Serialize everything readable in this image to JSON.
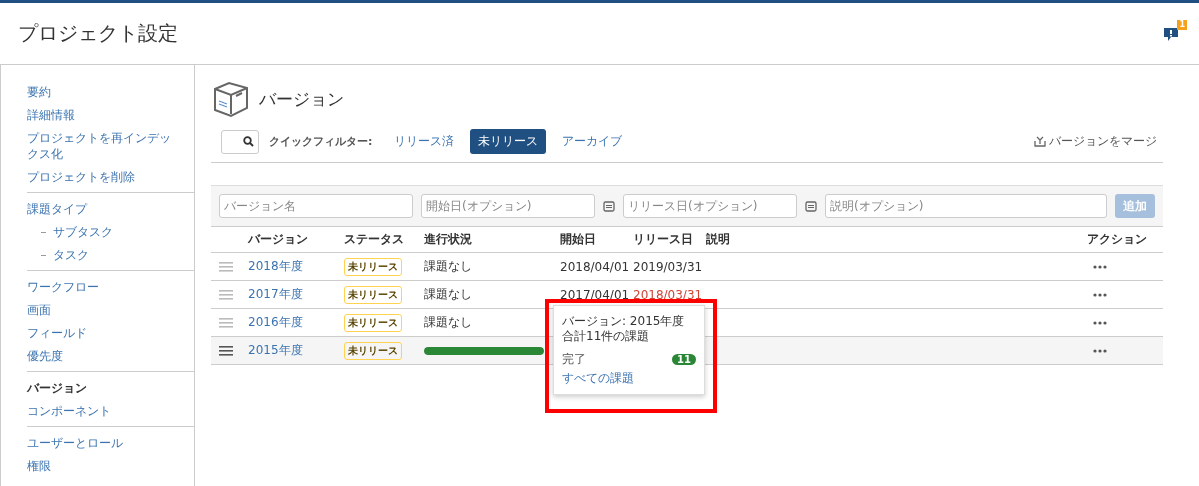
{
  "header": {
    "title": "プロジェクト設定",
    "notification_count": "1"
  },
  "sidebar": {
    "groups": [
      {
        "items": [
          {
            "label": "要約",
            "selected": false
          },
          {
            "label": "詳細情報",
            "selected": false
          },
          {
            "label": "プロジェクトを再インデックス化",
            "selected": false
          },
          {
            "label": "プロジェクトを削除",
            "selected": false
          }
        ]
      },
      {
        "items": [
          {
            "label": "課題タイプ",
            "selected": false,
            "children": [
              {
                "label": "サブタスク",
                "selected": false
              },
              {
                "label": "タスク",
                "selected": false
              }
            ]
          }
        ]
      },
      {
        "items": [
          {
            "label": "ワークフロー",
            "selected": false
          },
          {
            "label": "画面",
            "selected": false
          },
          {
            "label": "フィールド",
            "selected": false
          },
          {
            "label": "優先度",
            "selected": false
          }
        ]
      },
      {
        "items": [
          {
            "label": "バージョン",
            "selected": true
          },
          {
            "label": "コンポーネント",
            "selected": false
          }
        ]
      },
      {
        "items": [
          {
            "label": "ユーザーとロール",
            "selected": false
          },
          {
            "label": "権限",
            "selected": false
          }
        ]
      }
    ]
  },
  "page": {
    "title": "バージョン",
    "quick_filter": {
      "label": "クイックフィルター:",
      "filters": [
        {
          "label": "リリース済",
          "selected": false
        },
        {
          "label": "未リリース",
          "selected": true
        },
        {
          "label": "アーカイブ",
          "selected": false
        }
      ]
    },
    "merge_button": "バージョンをマージ",
    "add_form": {
      "name_placeholder": "バージョン名",
      "start_placeholder": "開始日(オプション)",
      "release_placeholder": "リリース日(オプション)",
      "description_placeholder": "説明(オプション)",
      "add_button": "追加",
      "add_disabled": true
    },
    "table": {
      "columns": [
        "バージョン",
        "ステータス",
        "進行状況",
        "開始日",
        "リリース日",
        "説明",
        "アクション"
      ],
      "rows": [
        {
          "version": "2018年度",
          "status": "未リリース",
          "progress": {
            "kind": "text",
            "text": "課題なし"
          },
          "start": "2018/04/01",
          "release": "2019/03/31",
          "overdue": false,
          "selected": false
        },
        {
          "version": "2017年度",
          "status": "未リリース",
          "progress": {
            "kind": "text",
            "text": "課題なし"
          },
          "start": "2017/04/01",
          "release": "2018/03/31",
          "overdue": true,
          "selected": false
        },
        {
          "version": "2016年度",
          "status": "未リリース",
          "progress": {
            "kind": "text",
            "text": "課題なし"
          },
          "selected": false
        },
        {
          "version": "2015年度",
          "status": "未リリース",
          "progress": {
            "kind": "bar",
            "level": 1
          },
          "selected": true
        }
      ]
    },
    "popup": {
      "title": "バージョン: 2015年度",
      "total": "合計11件の課題",
      "done_label": "完了",
      "done_count": "11",
      "all_link": "すべての課題"
    }
  }
}
